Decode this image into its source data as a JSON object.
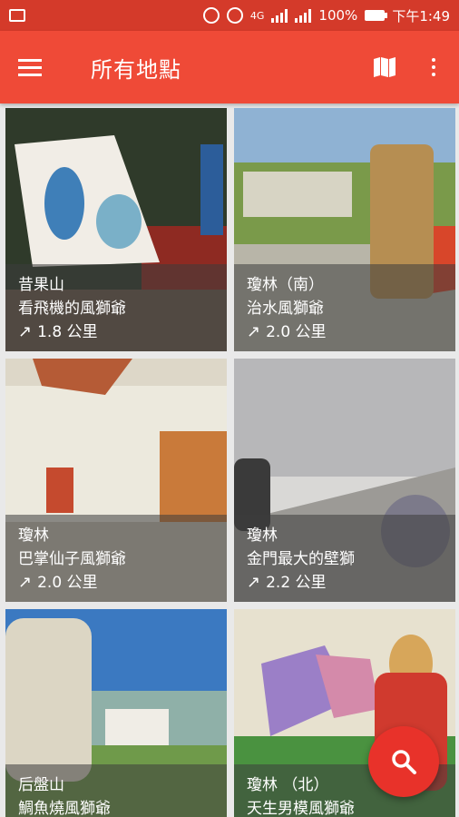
{
  "status_bar": {
    "battery": "100%",
    "time": "下午1:49",
    "network": "4G"
  },
  "app_bar": {
    "title": "所有地點"
  },
  "places": [
    {
      "area": "昔果山",
      "name": "看飛機的風獅爺",
      "distance": "1.8 公里"
    },
    {
      "area": "瓊林（南）",
      "name": "治水風獅爺",
      "distance": "2.0 公里"
    },
    {
      "area": "瓊林",
      "name": "巴掌仙子風獅爺",
      "distance": "2.0 公里"
    },
    {
      "area": "瓊林",
      "name": "金門最大的壁獅",
      "distance": "2.2 公里"
    },
    {
      "area": "后盤山",
      "name": "鯛魚燒風獅爺",
      "distance": ""
    },
    {
      "area": "瓊林 （北）",
      "name": "天生男模風獅爺",
      "distance": ""
    }
  ],
  "colors": {
    "status_bar": "#d43a2a",
    "app_bar": "#ef4a37",
    "fab": "#e8322a"
  },
  "icons": {
    "distance": "arrow-northeast-icon",
    "fab": "search-icon",
    "map": "map-icon",
    "menu": "hamburger-icon",
    "more": "more-vert-icon"
  }
}
